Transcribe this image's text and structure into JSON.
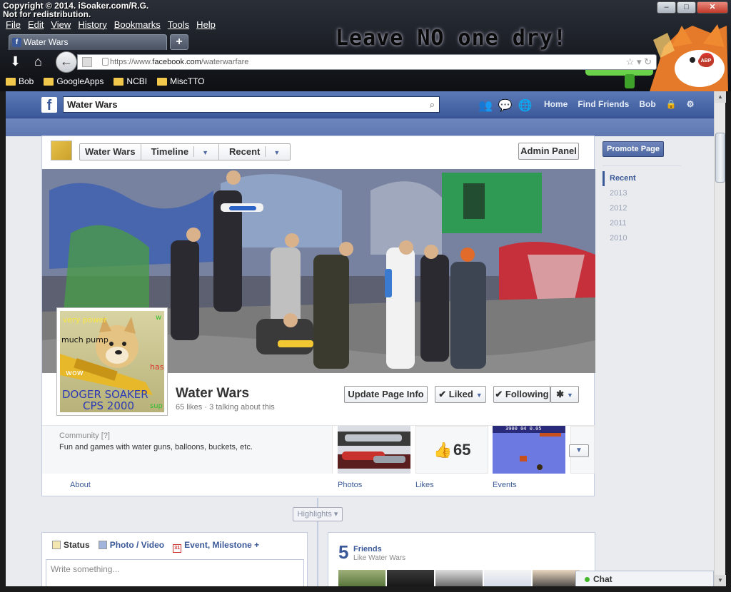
{
  "copyright": {
    "line1": "Copyright © 2014. iSoaker.com/R.G.",
    "line2": "Not for redistribution."
  },
  "window": {
    "minimize": "–",
    "maximize": "□",
    "close": "✕"
  },
  "menu": [
    "File",
    "Edit",
    "View",
    "History",
    "Bookmarks",
    "Tools",
    "Help"
  ],
  "tab": {
    "title": "Water Wars",
    "favicon": "f",
    "new_tab": "+"
  },
  "banner": {
    "text": "Leave NO one dry!"
  },
  "nav": {
    "back": "←",
    "url_prefix": "https://www.",
    "url_domain": "facebook.com",
    "url_path": "/waterwarfare",
    "star": "☆ ▾ ↻",
    "abp": "ABP"
  },
  "bookmarks": [
    "Bob",
    "GoogleApps",
    "NCBI",
    "MiscTTO"
  ],
  "fb": {
    "logo": "f",
    "search_value": "Water Wars",
    "nav": [
      "Home",
      "Find Friends",
      "Bob"
    ],
    "page": {
      "crumbs": [
        "Water Wars",
        "Timeline",
        "Recent"
      ],
      "admin_panel": "Admin Panel",
      "name": "Water Wars",
      "stats": "65 likes · 3 talking about this",
      "update_info": "Update Page Info",
      "liked": "✔ Liked",
      "following": "✔ Following",
      "gear": "✱",
      "category": "Community",
      "category_help": "[?]",
      "description": "Fun and games with water guns, balloons, buckets, etc.",
      "about_link": "About",
      "tiles": [
        {
          "label": "Photos"
        },
        {
          "label": "Likes",
          "value": "65"
        },
        {
          "label": "Events"
        }
      ],
      "more": "▼",
      "profile_text": {
        "very_power": "very power",
        "much_pump": "much pump",
        "wow": "wow",
        "has": "has",
        "w": "w",
        "sup": "sup",
        "doger1": "DOGER SOAKER",
        "doger2": "CPS 2000"
      },
      "event_score": "3900   04   0.05"
    },
    "highlights": "Highlights ▾",
    "composer": {
      "tabs": [
        "Status",
        "Photo / Video",
        "Event, Milestone +"
      ],
      "calendar_day": "31",
      "placeholder": "Write something..."
    },
    "friends": {
      "count": "5",
      "label": "Friends",
      "sub": "Like Water Wars"
    },
    "sidebar": {
      "promote": "Promote Page",
      "years": [
        "Recent",
        "2013",
        "2012",
        "2011",
        "2010"
      ]
    },
    "chat": "Chat"
  },
  "colors": {
    "fb_blue": "#3b5998",
    "chrome_dark": "#0d0f13",
    "page_bg": "#e9ebee"
  }
}
